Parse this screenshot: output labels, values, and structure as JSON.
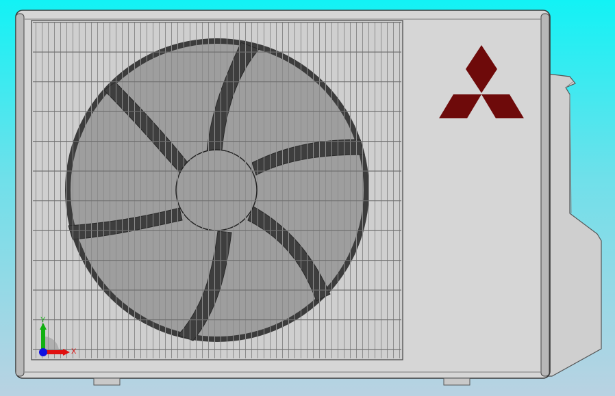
{
  "viewport": {
    "background_top": "#12f2f5",
    "background_bottom": "#b9d2e2"
  },
  "model": {
    "body_color": "#d3d3d3",
    "grille_color": "#8c8c8c",
    "fan_blade_color": "#3c3c3c",
    "fan_face_color": "#9e9e9e",
    "logo_color": "#6e0a0a",
    "logo_icon": "three-diamonds-logo"
  },
  "triad": {
    "x_label": "X",
    "y_label": "Y",
    "x_color": "#e01010",
    "y_color": "#10b010",
    "z_color": "#1010e0"
  }
}
